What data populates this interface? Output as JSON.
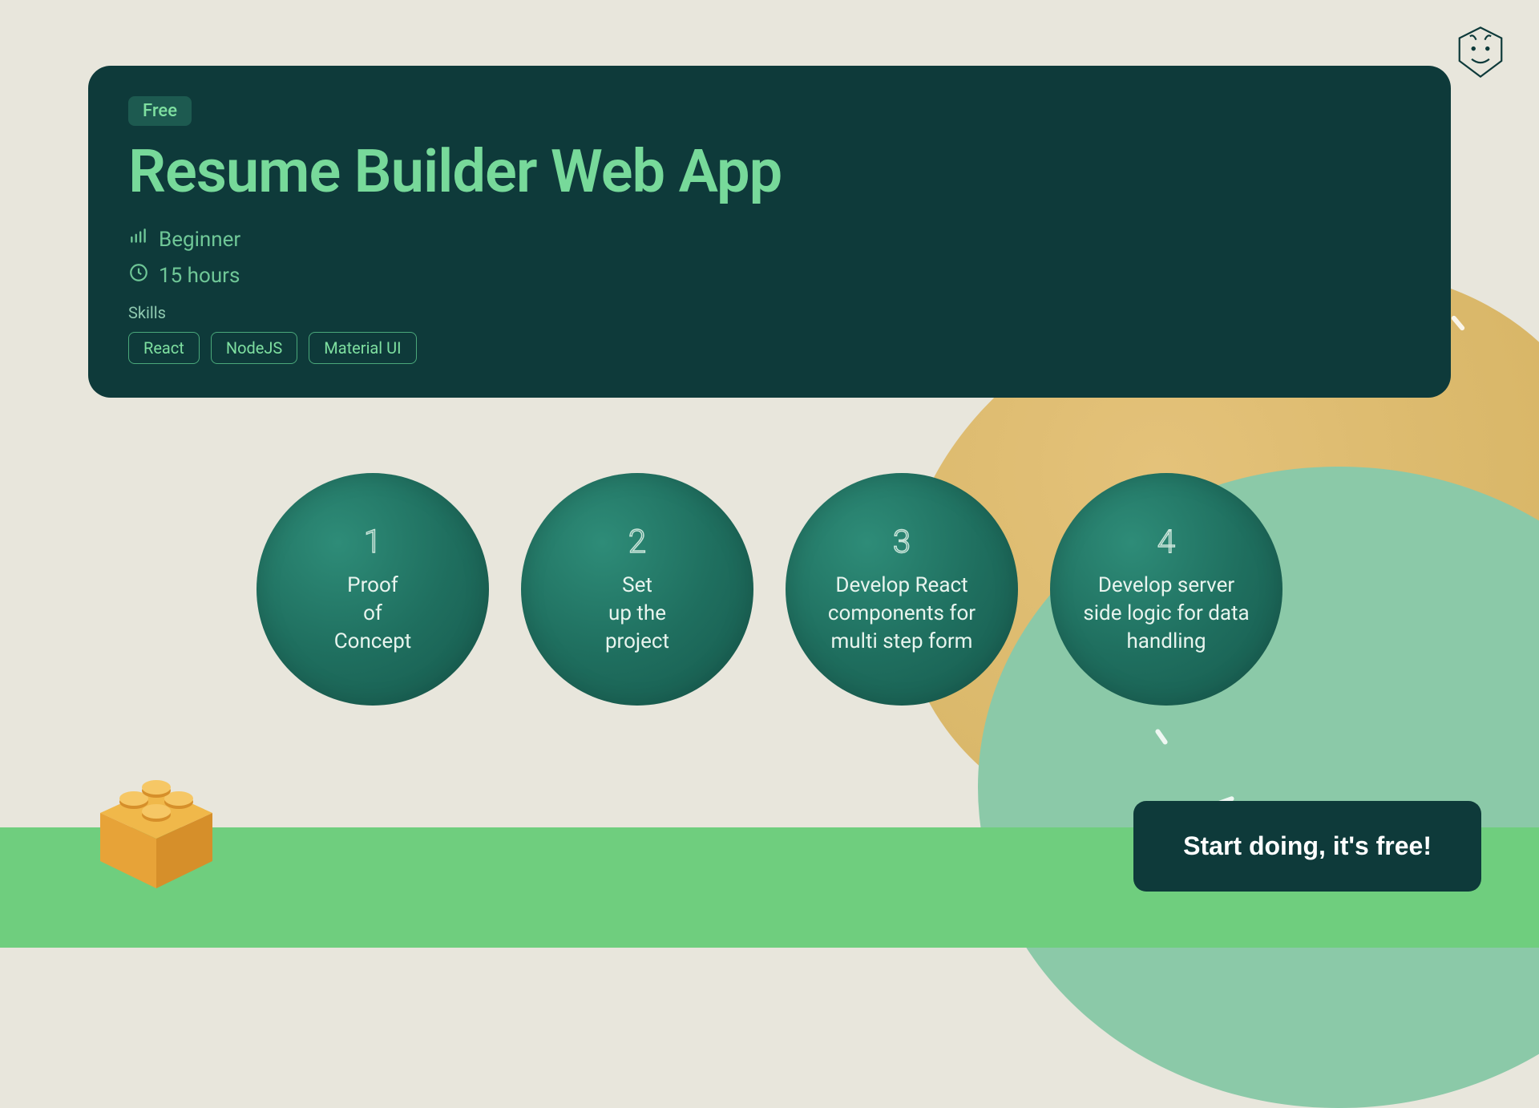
{
  "hero": {
    "badge": "Free",
    "title": "Resume Builder Web App",
    "level": "Beginner",
    "duration": "15 hours",
    "skills_label": "Skills",
    "skills": [
      "React",
      "NodeJS",
      "Material UI"
    ]
  },
  "steps": [
    {
      "num": "1",
      "text": "Proof\nof\nConcept"
    },
    {
      "num": "2",
      "text": "Set\nup the\nproject"
    },
    {
      "num": "3",
      "text": "Develop React components for multi step form"
    },
    {
      "num": "4",
      "text": "Develop server side logic for data handling"
    }
  ],
  "cta": {
    "label": "Start doing, it's free!"
  }
}
